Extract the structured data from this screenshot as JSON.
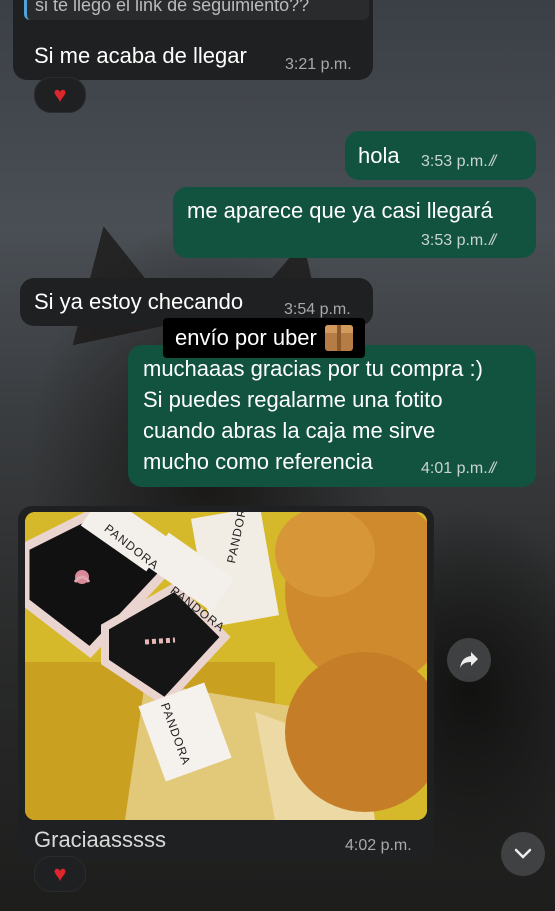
{
  "messages": [
    {
      "id": "m0",
      "direction": "in",
      "quoted_text": "si te llegó el link de seguimiento??",
      "text": "Si me acaba de llegar",
      "time": "3:21 p.m.",
      "reaction": "❤️"
    },
    {
      "id": "m1",
      "direction": "out",
      "text": "hola",
      "time": "3:53 p.m.",
      "status": "read"
    },
    {
      "id": "m2",
      "direction": "out",
      "text": "me aparece que ya casi llegará",
      "time": "3:53 p.m.",
      "status": "read"
    },
    {
      "id": "m3",
      "direction": "in",
      "text": "Si ya estoy checando",
      "time": "3:54 p.m."
    },
    {
      "id": "m4",
      "direction": "out",
      "text_lines": [
        "muchaaas gracias por tu compra :)",
        "Si puedes regalarme una fotito",
        "cuando abras la caja me sirve",
        "mucho como referencia"
      ],
      "time": "4:01 p.m.",
      "status": "read"
    },
    {
      "id": "m5",
      "direction": "in",
      "type": "image",
      "photo_labels": [
        "PANDORA",
        "PANDORA",
        "PANDORA",
        "PANDORA"
      ],
      "caption": "Graciaasssss",
      "time": "4:02 p.m.",
      "reaction": "❤️"
    }
  ],
  "sticker": {
    "text": "envío por uber",
    "icon": "package-icon"
  },
  "controls": {
    "forward_icon": "forward-icon",
    "scroll_down_icon": "chevron-down-icon"
  },
  "colors": {
    "incoming_bubble": "#1f2021",
    "outgoing_bubble": "#12533f",
    "heart": "#e0262d"
  }
}
